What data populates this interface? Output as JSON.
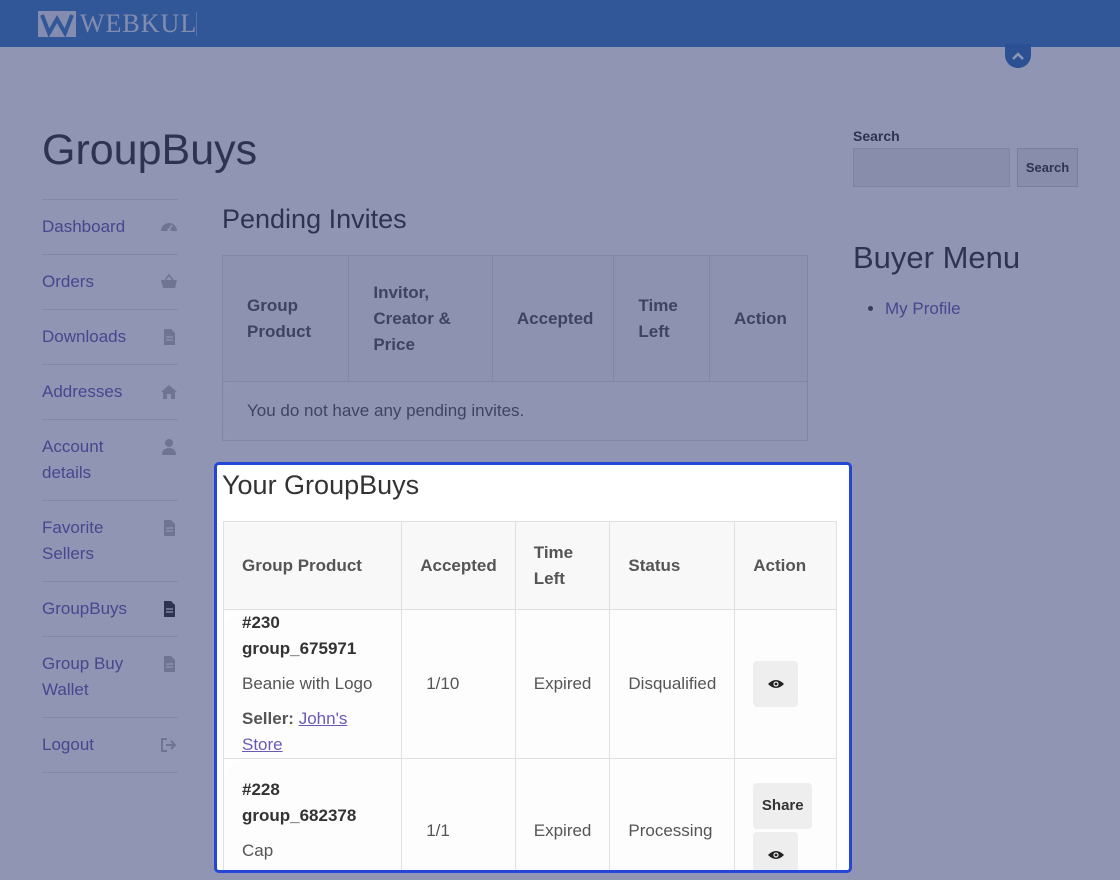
{
  "header": {
    "logo_text": "WEBKUL"
  },
  "page": {
    "title": "GroupBuys"
  },
  "nav": {
    "items": [
      {
        "label": "Dashboard",
        "icon": "dashboard-icon"
      },
      {
        "label": "Orders",
        "icon": "basket-icon"
      },
      {
        "label": "Downloads",
        "icon": "file-icon"
      },
      {
        "label": "Addresses",
        "icon": "home-icon"
      },
      {
        "label": "Account details",
        "icon": "user-icon"
      },
      {
        "label": "Favorite Sellers",
        "icon": "file-icon"
      },
      {
        "label": "GroupBuys",
        "icon": "file-icon",
        "active": true
      },
      {
        "label": "Group Buy Wallet",
        "icon": "file-icon"
      },
      {
        "label": "Logout",
        "icon": "logout-icon"
      }
    ]
  },
  "pending": {
    "title": "Pending Invites",
    "headers": [
      "Group Product",
      "Invitor, Creator & Price",
      "Accepted",
      "Time Left",
      "Action"
    ],
    "empty_text": "You do not have any pending invites."
  },
  "groupbuys": {
    "title": "Your GroupBuys",
    "headers": [
      "Group Product",
      "Accepted",
      "Time Left",
      "Status",
      "Action"
    ],
    "rows": [
      {
        "id": "#230",
        "code": "group_675971",
        "product": "Beanie with Logo",
        "seller_label": "Seller:",
        "seller": "John's Store",
        "accepted": "1/10",
        "time_left": "Expired",
        "status": "Disqualified"
      },
      {
        "id": "#228",
        "code": "group_682378",
        "product": "Cap",
        "accepted": "1/1",
        "time_left": "Expired",
        "status": "Processing",
        "share_label": "Share"
      }
    ]
  },
  "sidebar": {
    "search_label": "Search",
    "search_button": "Search",
    "buyer_menu_title": "Buyer Menu",
    "buyer_menu_items": [
      "My Profile"
    ]
  },
  "colors": {
    "header_bg": "#3b7ec9",
    "link": "#6b5ab5",
    "highlight_border": "#2346d6"
  }
}
